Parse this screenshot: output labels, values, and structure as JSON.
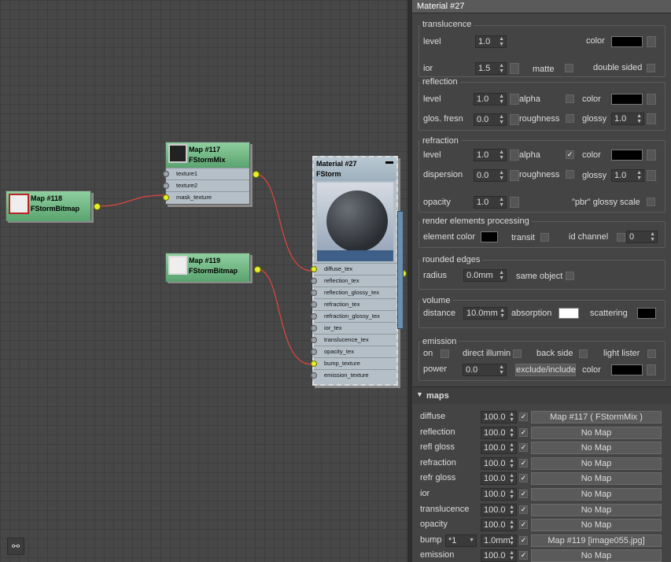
{
  "graph": {
    "node118": {
      "name": "Map #118",
      "type": "FStormBitmap"
    },
    "node117": {
      "name": "Map #117",
      "type": "FStormMix",
      "slots": [
        "texture1",
        "texture2",
        "mask_texture"
      ]
    },
    "node119": {
      "name": "Map #119",
      "type": "FStormBitmap"
    },
    "node27": {
      "name": "Material #27",
      "type": "FStorm",
      "slots": [
        "diffuse_tex",
        "reflection_tex",
        "reflection_glossy_tex",
        "refraction_tex",
        "refraction_glossy_tex",
        "ior_tex",
        "translucence_tex",
        "opacity_tex",
        "bump_texture",
        "emission_texture"
      ]
    },
    "binocular_icon": "binocular-icon"
  },
  "panel": {
    "title": "Material #27",
    "translucence": {
      "group": "translucence",
      "level_label": "level",
      "level": "1.0",
      "color_label": "color",
      "ior_label": "ior",
      "ior": "1.5",
      "matte_label": "matte",
      "double_sided_label": "double sided"
    },
    "reflection": {
      "group": "reflection",
      "level_label": "level",
      "level": "1.0",
      "alpha_label": "alpha",
      "color_label": "color",
      "glos_fresn_label": "glos. fresn",
      "glos_fresn": "0.0",
      "roughness_label": "roughness",
      "glossy_label": "glossy",
      "glossy": "1.0"
    },
    "refraction": {
      "group": "refraction",
      "level_label": "level",
      "level": "1.0",
      "alpha_label": "alpha",
      "color_label": "color",
      "dispersion_label": "dispersion",
      "dispersion": "0.0",
      "roughness_label": "roughness",
      "glossy_label": "glossy",
      "glossy": "1.0",
      "opacity_label": "opacity",
      "opacity": "1.0",
      "pbr_label": "\"pbr\" glossy scale"
    },
    "render_elements": {
      "group": "render elements processing",
      "element_color_label": "element color",
      "transit_label": "transit",
      "id_channel_label": "id channel",
      "id_channel": "0"
    },
    "rounded": {
      "group": "rounded edges",
      "radius_label": "radius",
      "radius": "0.0mm",
      "same_object_label": "same object"
    },
    "volume": {
      "group": "volume",
      "distance_label": "distance",
      "distance": "10.0mm",
      "absorption_label": "absorption",
      "scattering_label": "scattering"
    },
    "emission": {
      "group": "emission",
      "on_label": "on",
      "direct_label": "direct illumin",
      "back_side_label": "back side",
      "light_lister_label": "light lister",
      "power_label": "power",
      "power": "0.0",
      "exclude_label": "exclude/include",
      "color_label": "color"
    },
    "maps": {
      "header": "maps",
      "rows": [
        {
          "label": "diffuse",
          "amount": "100.0",
          "map": "Map #117  ( FStormMix )"
        },
        {
          "label": "reflection",
          "amount": "100.0",
          "map": "No Map"
        },
        {
          "label": "refl gloss",
          "amount": "100.0",
          "map": "No Map"
        },
        {
          "label": "refraction",
          "amount": "100.0",
          "map": "No Map"
        },
        {
          "label": "refr gloss",
          "amount": "100.0",
          "map": "No Map"
        },
        {
          "label": "ior",
          "amount": "100.0",
          "map": "No Map"
        },
        {
          "label": "translucence",
          "amount": "100.0",
          "map": "No Map"
        },
        {
          "label": "opacity",
          "amount": "100.0",
          "map": "No Map"
        },
        {
          "label": "bump",
          "amount": "1.0mm",
          "map": "Map #119 [image055.jpg]",
          "multiplier": "*1"
        },
        {
          "label": "emission",
          "amount": "100.0",
          "map": "No Map"
        }
      ]
    }
  },
  "colors": {
    "wire": "#e0463c",
    "node_green": "#6fbf86",
    "pin_active": "#e4f02b"
  }
}
